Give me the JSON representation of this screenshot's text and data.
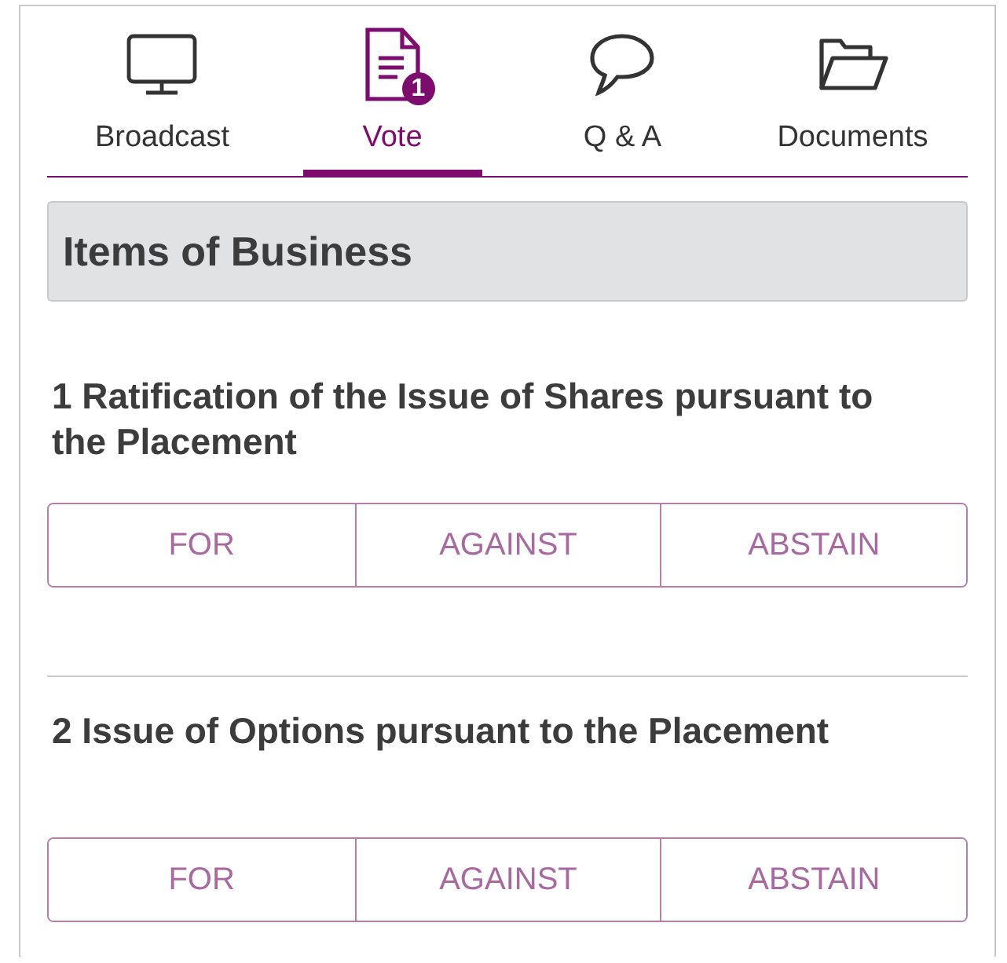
{
  "tabs": [
    {
      "label": "Broadcast",
      "selected": false
    },
    {
      "label": "Vote",
      "selected": true,
      "badge": "1"
    },
    {
      "label": "Q & A",
      "selected": false
    },
    {
      "label": "Documents",
      "selected": false
    }
  ],
  "section": {
    "title": "Items of Business"
  },
  "items": [
    {
      "title": "1 Ratification of the Issue of Shares pursuant to the Placement",
      "options": [
        {
          "label": "FOR",
          "selected": false
        },
        {
          "label": "AGAINST",
          "selected": false
        },
        {
          "label": "ABSTAIN",
          "selected": false
        }
      ]
    },
    {
      "title": "2 Issue of Options pursuant to the Placement",
      "options": [
        {
          "label": "FOR",
          "selected": false
        },
        {
          "label": "AGAINST",
          "selected": false
        },
        {
          "label": "ABSTAIN",
          "selected": false
        }
      ]
    }
  ]
}
